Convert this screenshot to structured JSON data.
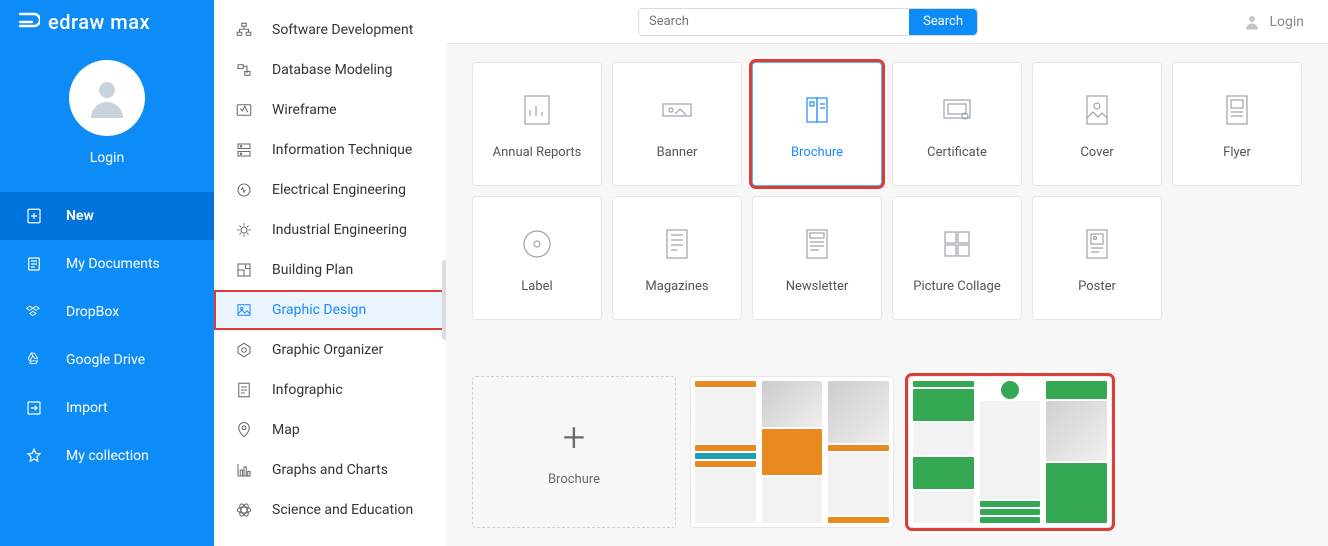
{
  "brand": "edraw max",
  "sidebar": {
    "login": "Login",
    "items": [
      {
        "label": "New",
        "active": true
      },
      {
        "label": "My Documents"
      },
      {
        "label": "DropBox"
      },
      {
        "label": "Google Drive"
      },
      {
        "label": "Import"
      },
      {
        "label": "My collection"
      }
    ]
  },
  "categories": {
    "items": [
      {
        "label": "Software Development"
      },
      {
        "label": "Database Modeling"
      },
      {
        "label": "Wireframe"
      },
      {
        "label": "Information Technique"
      },
      {
        "label": "Electrical Engineering"
      },
      {
        "label": "Industrial Engineering"
      },
      {
        "label": "Building Plan"
      },
      {
        "label": "Graphic Design",
        "selected": true,
        "highlight": true
      },
      {
        "label": "Graphic Organizer"
      },
      {
        "label": "Infographic"
      },
      {
        "label": "Map"
      },
      {
        "label": "Graphs and Charts"
      },
      {
        "label": "Science and Education"
      }
    ]
  },
  "search": {
    "placeholder": "Search",
    "button": "Search"
  },
  "top_login": "Login",
  "tiles": [
    {
      "label": "Annual Reports"
    },
    {
      "label": "Banner"
    },
    {
      "label": "Brochure",
      "selected": true
    },
    {
      "label": "Certificate"
    },
    {
      "label": "Cover"
    },
    {
      "label": "Flyer"
    },
    {
      "label": "Label"
    },
    {
      "label": "Magazines"
    },
    {
      "label": "Newsletter"
    },
    {
      "label": "Picture Collage"
    },
    {
      "label": "Poster"
    }
  ],
  "templates": {
    "empty_label": "Brochure",
    "items": [
      {
        "theme": "orange"
      },
      {
        "theme": "green",
        "highlight": true
      }
    ]
  }
}
